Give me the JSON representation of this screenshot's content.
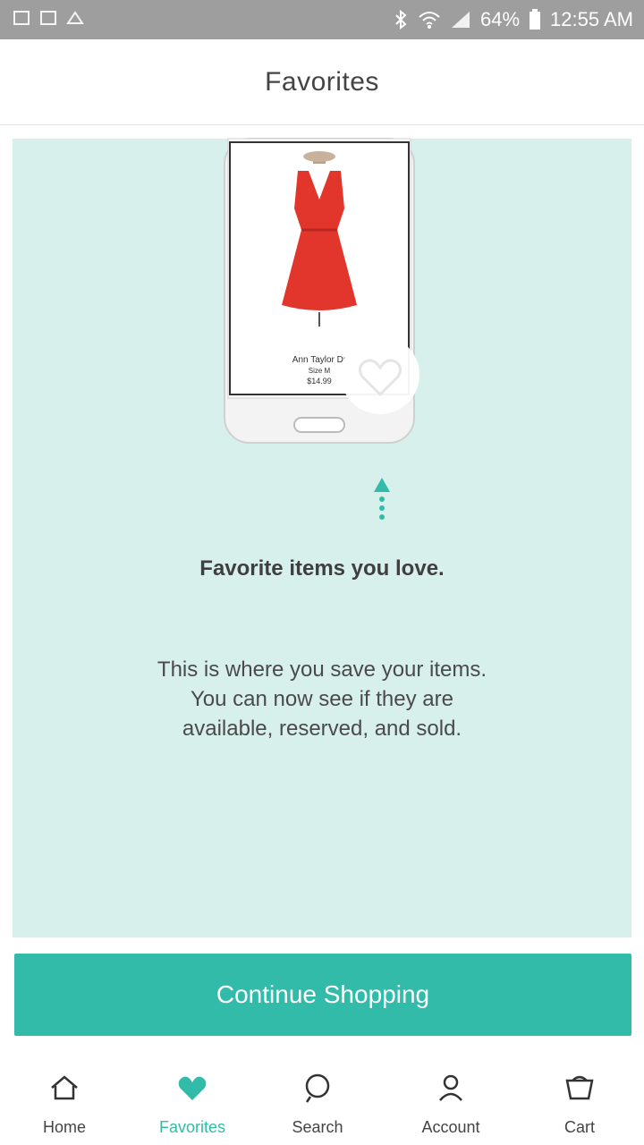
{
  "status_bar": {
    "battery": "64%",
    "time": "12:55 AM"
  },
  "header": {
    "title": "Favorites"
  },
  "illustration": {
    "product_name": "Ann Taylor Dr",
    "product_size": "Size M",
    "product_price": "$14.99"
  },
  "empty_state": {
    "title": "Favorite items you love.",
    "line1": "This is where you save your items.",
    "line2": "You can now see if they are",
    "line3": "available, reserved, and sold."
  },
  "cta": {
    "label": "Continue Shopping"
  },
  "bottom_nav": [
    {
      "label": "Home",
      "icon": "home-icon"
    },
    {
      "label": "Favorites",
      "icon": "heart-icon",
      "active": true
    },
    {
      "label": "Search",
      "icon": "search-icon"
    },
    {
      "label": "Account",
      "icon": "account-icon"
    },
    {
      "label": "Cart",
      "icon": "cart-icon"
    }
  ],
  "colors": {
    "accent": "#32bba9",
    "panel": "#d8f0ec",
    "statusbar": "#9e9e9e"
  }
}
